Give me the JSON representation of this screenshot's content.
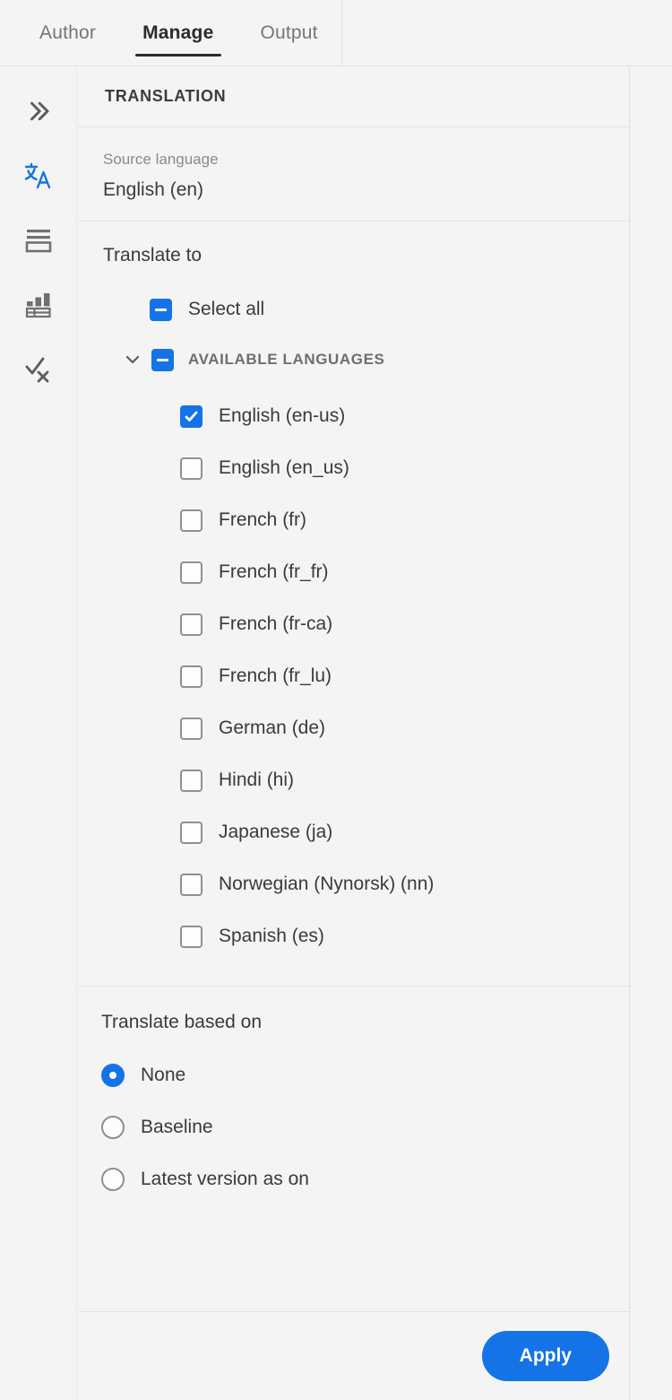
{
  "tabs": [
    {
      "label": "Author",
      "active": false
    },
    {
      "label": "Manage",
      "active": true
    },
    {
      "label": "Output",
      "active": false
    }
  ],
  "rail": {
    "items": [
      {
        "name": "expand-panel-icon",
        "icon": "chevron-double-right",
        "active": false
      },
      {
        "name": "translation-icon",
        "icon": "translate",
        "active": true
      },
      {
        "name": "conditions-icon",
        "icon": "list-box",
        "active": false
      },
      {
        "name": "reports-icon",
        "icon": "bar-chart-table",
        "active": false
      },
      {
        "name": "review-icon",
        "icon": "check-x",
        "active": false
      }
    ]
  },
  "panel": {
    "title": "TRANSLATION",
    "source": {
      "label": "Source language",
      "value": "English (en)"
    },
    "translate_to": {
      "label": "Translate to",
      "select_all": {
        "label": "Select all",
        "state": "mixed"
      },
      "group": {
        "label": "AVAILABLE LANGUAGES",
        "state": "mixed",
        "expanded": true
      },
      "languages": [
        {
          "label": "English (en-us)",
          "checked": true
        },
        {
          "label": "English (en_us)",
          "checked": false
        },
        {
          "label": "French (fr)",
          "checked": false
        },
        {
          "label": "French (fr_fr)",
          "checked": false
        },
        {
          "label": "French (fr-ca)",
          "checked": false
        },
        {
          "label": "French (fr_lu)",
          "checked": false
        },
        {
          "label": "German (de)",
          "checked": false
        },
        {
          "label": "Hindi (hi)",
          "checked": false
        },
        {
          "label": "Japanese (ja)",
          "checked": false
        },
        {
          "label": "Norwegian (Nynorsk) (nn)",
          "checked": false
        },
        {
          "label": "Spanish (es)",
          "checked": false
        }
      ]
    },
    "translate_based_on": {
      "label": "Translate based on",
      "options": [
        {
          "label": "None",
          "selected": true
        },
        {
          "label": "Baseline",
          "selected": false
        },
        {
          "label": "Latest version as on",
          "selected": false
        }
      ]
    },
    "footer": {
      "apply_label": "Apply"
    }
  },
  "colors": {
    "accent": "#1473e6",
    "background": "#f4f4f4",
    "border": "#e4e4e4",
    "text": "#3a3a3a",
    "muted": "#8a8a8a"
  }
}
